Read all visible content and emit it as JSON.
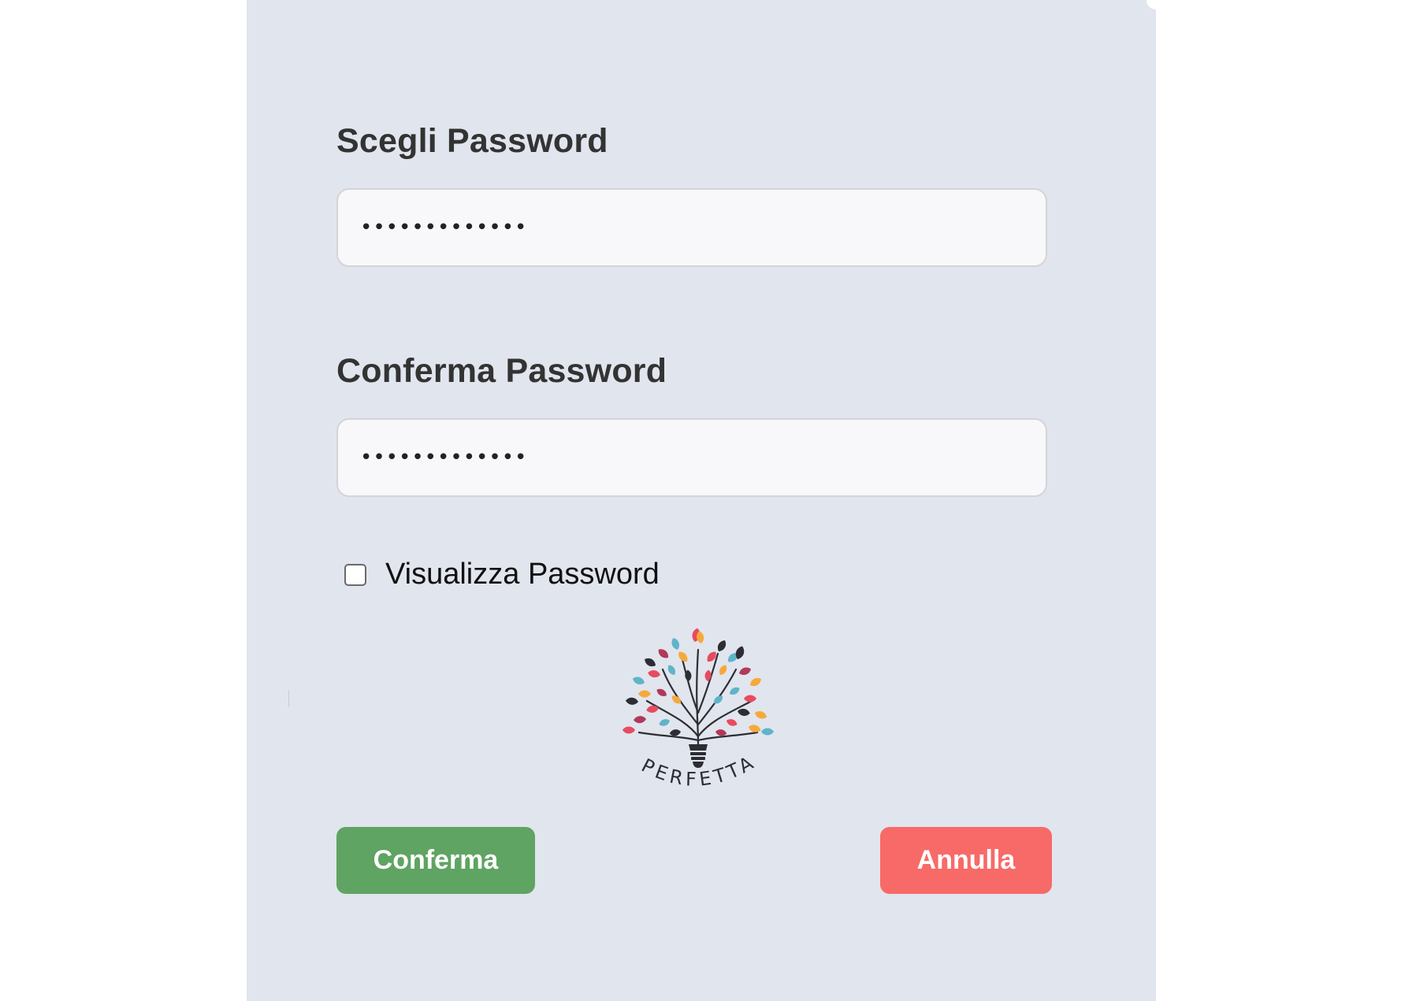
{
  "form": {
    "password_label": "Scegli Password",
    "password_value": "•••••••••••••",
    "confirm_label": "Conferma Password",
    "confirm_value": "•••••••••••••",
    "show_password_label": "Visualizza Password",
    "show_password_checked": false
  },
  "logo": {
    "icon": "tree-lightbulb-logo",
    "text": "PERFETTA"
  },
  "actions": {
    "confirm_label": "Conferma",
    "cancel_label": "Annulla"
  },
  "colors": {
    "panel_bg": "#e1e5ee",
    "confirm_bg": "#5fa462",
    "cancel_bg": "#f76a67",
    "input_bg": "#f8f8fa"
  }
}
